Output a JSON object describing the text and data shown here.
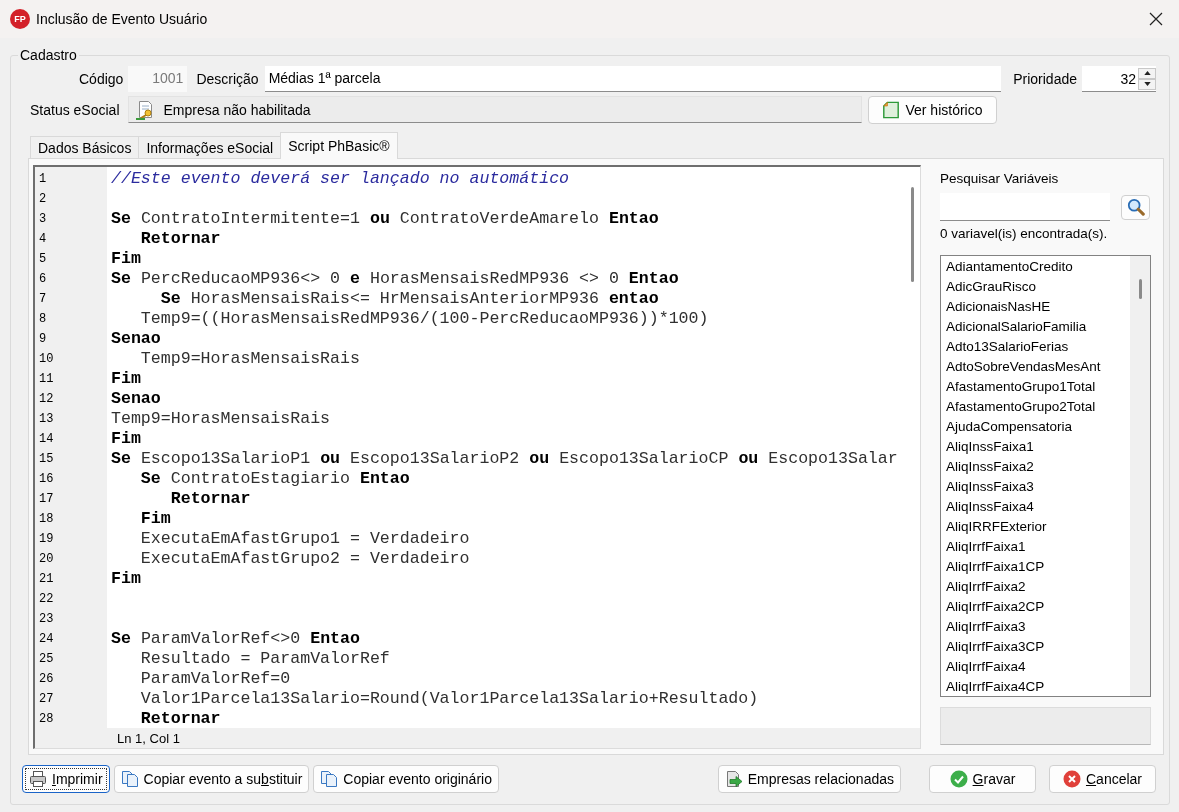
{
  "window": {
    "logo": "FP",
    "title": "Inclusão de Evento Usuário"
  },
  "cadastro": {
    "legend": "Cadastro",
    "codigo": {
      "label": "Código",
      "value": "1001",
      "read_only": true
    },
    "descricao": {
      "label": "Descrição",
      "value": "Médias 1ª parcela",
      "read_only": false
    },
    "prioridade": {
      "label": "Prioridade",
      "value": "32"
    },
    "status_esocial": {
      "label": "Status eSocial",
      "value": "Empresa não habilitada"
    },
    "history_button": {
      "label": "Ver histórico"
    }
  },
  "tabs": [
    {
      "label": "Dados Básicos",
      "selected": false
    },
    {
      "label": "Informações eSocial",
      "selected": false
    },
    {
      "label": "Script PhBasic®",
      "selected": true
    }
  ],
  "script": {
    "lines": [
      {
        "number": "1",
        "kind": "comment",
        "text": "//Este evento deverá ser lançado no automático"
      },
      {
        "number": "2",
        "kind": "blank"
      },
      {
        "number": "3",
        "kind": "code",
        "text": "**Se** ContratoIntermitente=1 **ou** ContratoVerdeAmarelo **Entao**"
      },
      {
        "number": "4",
        "kind": "code",
        "text": "   **Retornar**"
      },
      {
        "number": "5",
        "kind": "code",
        "text": "**Fim**"
      },
      {
        "number": "6",
        "kind": "code",
        "text": "**Se** PercReducaoMP936<> 0 **e** HorasMensaisRedMP936 <> 0 **Entao**"
      },
      {
        "number": "7",
        "kind": "code",
        "text": "     **Se** HorasMensaisRais<= HrMensaisAnteriorMP936 **entao**"
      },
      {
        "number": "8",
        "kind": "code",
        "text": "   Temp9=((HorasMensaisRedMP936/(100-PercReducaoMP936))*100)"
      },
      {
        "number": "9",
        "kind": "code",
        "text": "**Senao**"
      },
      {
        "number": "10",
        "kind": "code",
        "text": "   Temp9=HorasMensaisRais"
      },
      {
        "number": "11",
        "kind": "code",
        "text": "**Fim**"
      },
      {
        "number": "12",
        "kind": "code",
        "text": "**Senao**"
      },
      {
        "number": "13",
        "kind": "code",
        "text": "Temp9=HorasMensaisRais"
      },
      {
        "number": "14",
        "kind": "code",
        "text": "**Fim**"
      },
      {
        "number": "15",
        "kind": "code",
        "text": "**Se** Escopo13SalarioP1 **ou** Escopo13SalarioP2 **ou** Escopo13SalarioCP **ou** Escopo13Salar"
      },
      {
        "number": "16",
        "kind": "code",
        "text": "   **Se** ContratoEstagiario **Entao**"
      },
      {
        "number": "17",
        "kind": "code",
        "text": "      **Retornar**"
      },
      {
        "number": "18",
        "kind": "code",
        "text": "   **Fim**"
      },
      {
        "number": "19",
        "kind": "code",
        "text": "   ExecutaEmAfastGrupo1 = Verdadeiro"
      },
      {
        "number": "20",
        "kind": "code",
        "text": "   ExecutaEmAfastGrupo2 = Verdadeiro"
      },
      {
        "number": "21",
        "kind": "code",
        "text": "**Fim**"
      },
      {
        "number": "22",
        "kind": "blank"
      },
      {
        "number": "23",
        "kind": "blank"
      },
      {
        "number": "24",
        "kind": "code",
        "text": "**Se** ParamValorRef<>0 **Entao**"
      },
      {
        "number": "25",
        "kind": "code",
        "text": "   Resultado = ParamValorRef"
      },
      {
        "number": "26",
        "kind": "code",
        "text": "   ParamValorRef=0"
      },
      {
        "number": "27",
        "kind": "code",
        "text": "   Valor1Parcela13Salario=Round(Valor1Parcela13Salario+Resultado)"
      },
      {
        "number": "28",
        "kind": "code",
        "text": "   **Retornar**"
      }
    ],
    "status": "Ln 1, Col 1"
  },
  "variables": {
    "title": "Pesquisar Variáveis",
    "count_text": "0 variavel(is) encontrada(s).",
    "items": [
      {
        "name": "AdiantamentoCredito",
        "selected": false
      },
      {
        "name": "AdicGrauRisco",
        "selected": false
      },
      {
        "name": "AdicionaisNasHE",
        "selected": false
      },
      {
        "name": "AdicionalSalarioFamilia",
        "selected": false
      },
      {
        "name": "Adto13SalarioFerias",
        "selected": false
      },
      {
        "name": "AdtoSobreVendasMesAnt",
        "selected": false
      },
      {
        "name": "AfastamentoGrupo1Total",
        "selected": false
      },
      {
        "name": "AfastamentoGrupo2Total",
        "selected": false
      },
      {
        "name": "AjudaCompensatoria",
        "selected": false
      },
      {
        "name": "AliqInssFaixa1",
        "selected": false
      },
      {
        "name": "AliqInssFaixa2",
        "selected": false
      },
      {
        "name": "AliqInssFaixa3",
        "selected": false
      },
      {
        "name": "AliqInssFaixa4",
        "selected": false
      },
      {
        "name": "AliqIRRFExterior",
        "selected": false
      },
      {
        "name": "AliqIrrfFaixa1",
        "selected": false
      },
      {
        "name": "AliqIrrfFaixa1CP",
        "selected": false
      },
      {
        "name": "AliqIrrfFaixa2",
        "selected": false
      },
      {
        "name": "AliqIrrfFaixa2CP",
        "selected": false
      },
      {
        "name": "AliqIrrfFaixa3",
        "selected": false
      },
      {
        "name": "AliqIrrfFaixa3CP",
        "selected": false
      },
      {
        "name": "AliqIrrfFaixa4",
        "selected": false
      },
      {
        "name": "AliqIrrfFaixa4CP",
        "selected": false
      }
    ]
  },
  "left_buttons": [
    {
      "kind": "print",
      "label": {
        "key": "I",
        "after": "mprimir"
      },
      "focused": true
    },
    {
      "kind": "copy",
      "label": {
        "before": "Copiar evento a su",
        "key": "b",
        "after": "stituir"
      },
      "focused": false
    },
    {
      "kind": "copy",
      "label": {
        "before": "Copiar evento originário"
      },
      "focused": false
    }
  ],
  "right_buttons": [
    {
      "kind": "companies",
      "label": {
        "before": "Empresas relacionadas"
      },
      "focused": false
    },
    {
      "kind": "save",
      "label": {
        "key": "G",
        "after": "ravar"
      },
      "focused": false
    },
    {
      "kind": "cancel",
      "label": {
        "key": "C",
        "after": "ancelar"
      },
      "focused": false
    }
  ]
}
